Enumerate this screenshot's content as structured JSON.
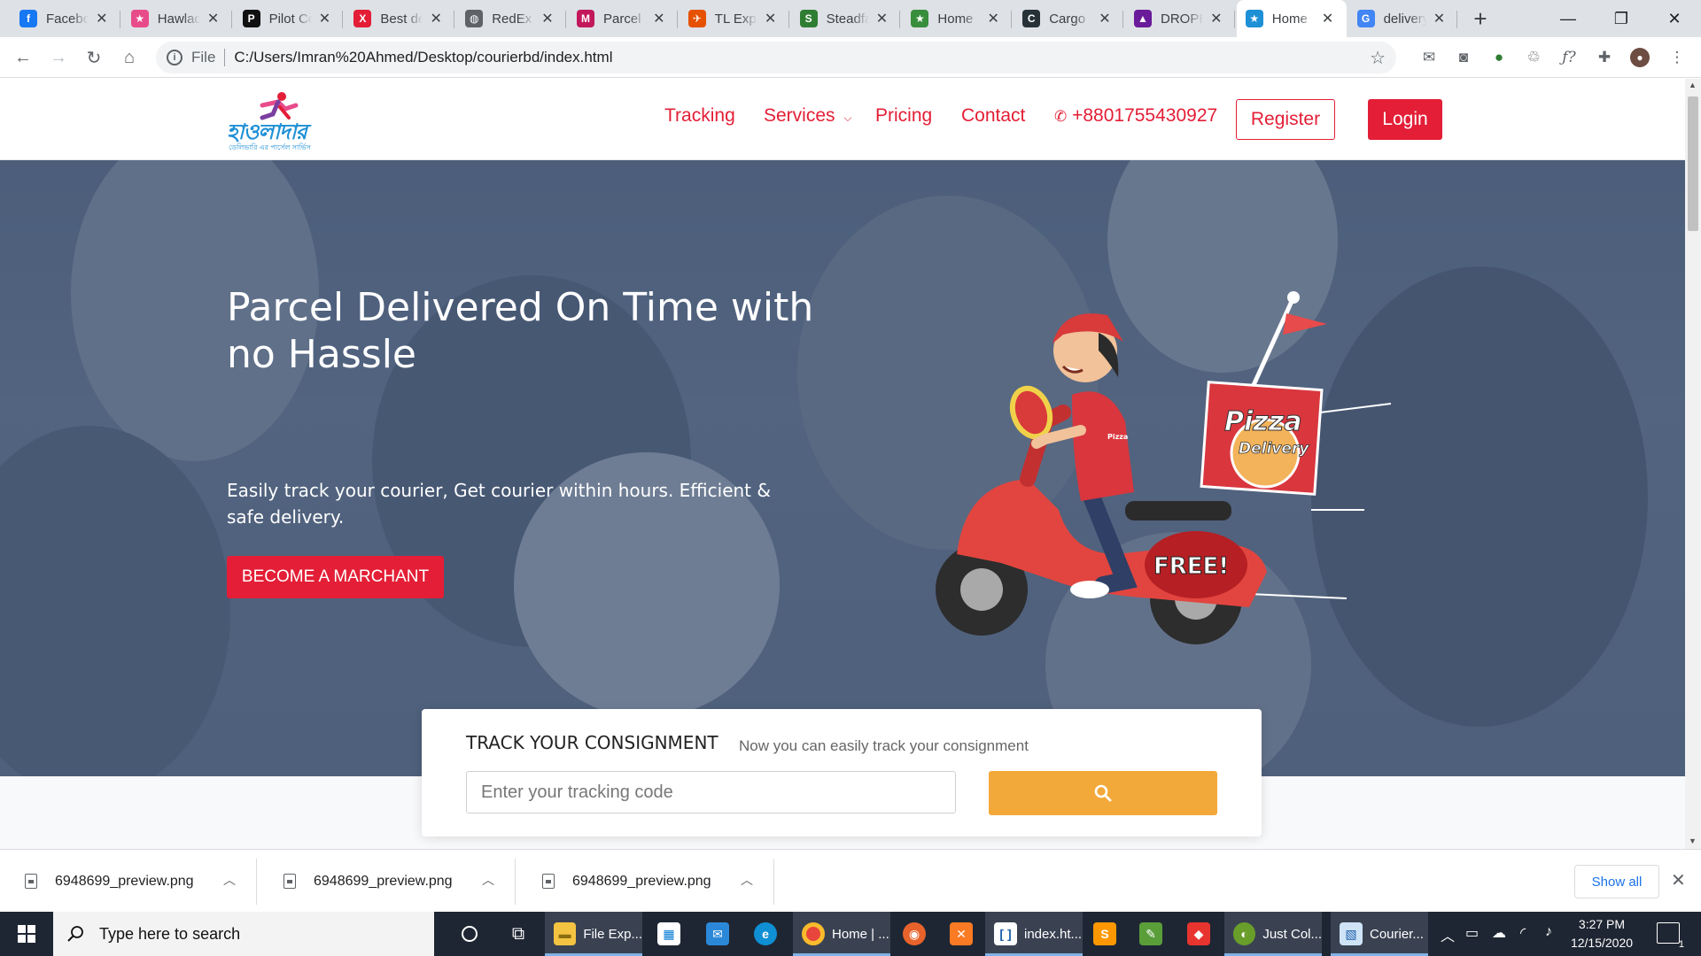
{
  "browser": {
    "tabs": [
      {
        "title": "Facebook",
        "icon": "facebook-icon",
        "color": "#1877f2",
        "glyph": "f"
      },
      {
        "title": "Hawladar",
        "icon": "runner-icon",
        "color": "#e84b8a",
        "glyph": "★"
      },
      {
        "title": "Pilot Courier",
        "icon": "pilot-icon",
        "color": "#111111",
        "glyph": "P"
      },
      {
        "title": "Best deal",
        "icon": "x-brand-icon",
        "color": "#e31e36",
        "glyph": "X"
      },
      {
        "title": "RedEx",
        "icon": "globe-icon",
        "color": "#5f6368",
        "glyph": "◍"
      },
      {
        "title": "Parcel",
        "icon": "parcel-icon",
        "color": "#c2185b",
        "glyph": "M"
      },
      {
        "title": "TL Express",
        "icon": "plane-icon",
        "color": "#e65100",
        "glyph": "✈"
      },
      {
        "title": "Steadfast",
        "icon": "steadfast-icon",
        "color": "#2e7d32",
        "glyph": "S"
      },
      {
        "title": "Home",
        "icon": "runner-green-icon",
        "color": "#388e3c",
        "glyph": "★"
      },
      {
        "title": "Cargo",
        "icon": "cargo-icon",
        "color": "#263238",
        "glyph": "C"
      },
      {
        "title": "DROPE",
        "icon": "drop-icon",
        "color": "#6a1b9a",
        "glyph": "▲"
      },
      {
        "title": "Home",
        "icon": "runner-icon",
        "color": "#1e90d6",
        "glyph": "★",
        "active": true
      },
      {
        "title": "delivery",
        "icon": "google-icon",
        "color": "#4285f4",
        "glyph": "G"
      }
    ],
    "window_controls": {
      "minimize": "—",
      "maximize": "❐",
      "close": "✕"
    },
    "address": {
      "scheme_label": "File",
      "url": "C:/Users/Imran%20Ahmed/Desktop/courierbd/index.html"
    }
  },
  "site": {
    "brand": "হাওলাদার",
    "tagline": "ডেলিভারি এর পার্সেল সার্ভিস",
    "nav": {
      "tracking": "Tracking",
      "services": "Services",
      "pricing": "Pricing",
      "contact": "Contact",
      "phone": "+8801755430927",
      "register": "Register",
      "login": "Login"
    },
    "hero": {
      "title": "Parcel Delivered On Time with no Hassle",
      "subtitle": "Easily track your courier, Get courier within hours. Efficient & safe delivery.",
      "cta": "BECOME A MARCHANT",
      "illustration": {
        "box_line1": "Pizza",
        "box_line2": "Delivery",
        "badge": "FREE!",
        "shirt": "Pizza"
      }
    },
    "track": {
      "title": "TRACK YOUR CONSIGNMENT",
      "subtitle": "Now you can easily track your consignment",
      "placeholder": "Enter your tracking code"
    },
    "colors": {
      "accent": "#e31e36",
      "search_button": "#f3a93a",
      "logo_blue": "#1e90d6"
    }
  },
  "downloads": {
    "items": [
      "6948699_preview.png",
      "6948699_preview.png",
      "6948699_preview.png"
    ],
    "show_all": "Show all"
  },
  "taskbar": {
    "search_placeholder": "Type here to search",
    "apps": [
      {
        "label": "File Exp...",
        "icon": "folder-icon"
      },
      {
        "label": "Home | ...",
        "icon": "chrome-icon"
      },
      {
        "label": "index.ht...",
        "icon": "brackets-icon"
      },
      {
        "label": "Just Col...",
        "icon": "colorpicker-icon"
      },
      {
        "label": "Courier...",
        "icon": "image-viewer-icon"
      }
    ],
    "time": "3:27 PM",
    "date": "12/15/2020",
    "notification_count": "1"
  }
}
